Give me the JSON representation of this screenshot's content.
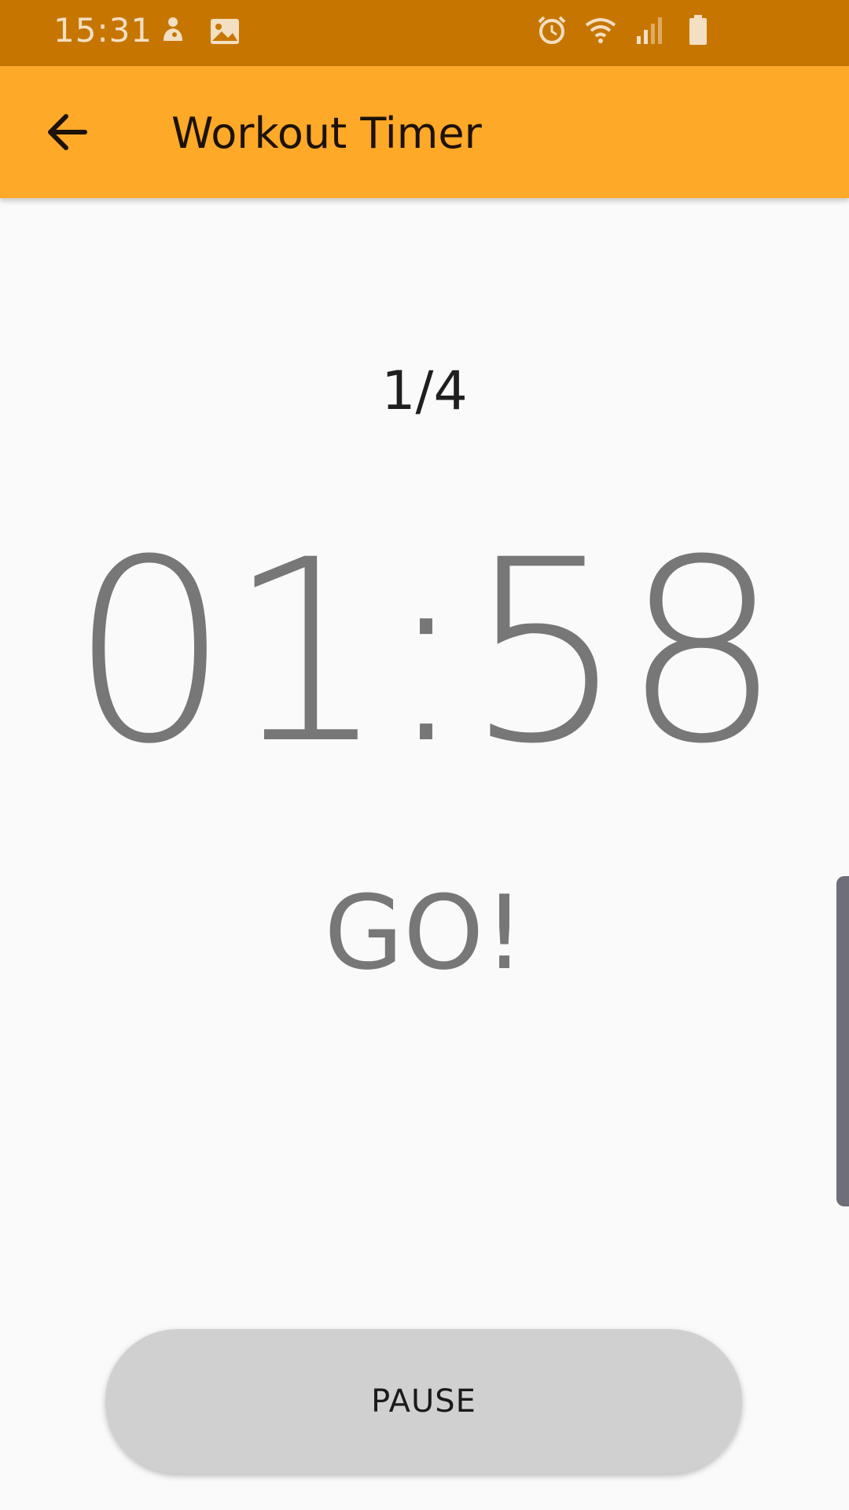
{
  "status_bar": {
    "time": "15:31",
    "left_icons": [
      "android-notification-icon",
      "image-icon"
    ],
    "right_icons": [
      "alarm-icon",
      "wifi-icon",
      "signal-icon",
      "battery-icon"
    ],
    "background": "#c67600"
  },
  "app_bar": {
    "title": "Workout Timer",
    "back_icon": "arrow-back-icon",
    "background": "#ffa929"
  },
  "timer": {
    "round": "1/4",
    "time": "01:58",
    "phase": "GO!"
  },
  "controls": {
    "pause_label": "PAUSE"
  }
}
